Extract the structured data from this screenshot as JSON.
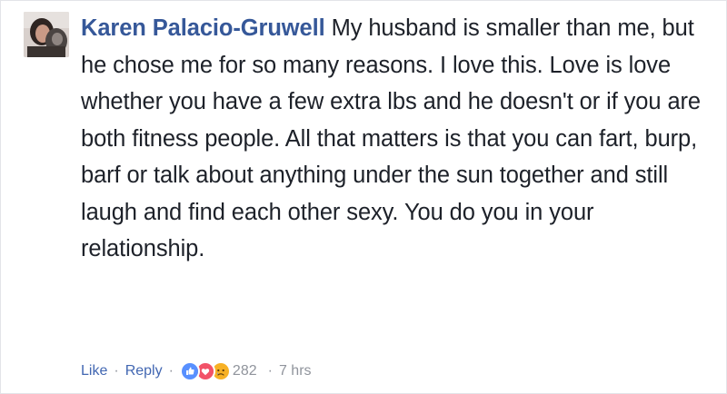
{
  "comment": {
    "author": "Karen Palacio-Gruwell",
    "text": "My husband is smaller than me, but he chose me for so many reasons. I love this. Love is love whether you have a few extra lbs and he doesn't or if you are both fitness people. All that matters is that you can fart, burp, barf or talk about anything under the sun together and still laugh and find each other sexy. You do you in your relationship."
  },
  "actions": {
    "like_label": "Like",
    "separator": "·",
    "reply_label": "Reply",
    "reaction_icons": [
      "like-icon",
      "love-icon",
      "sad-icon"
    ],
    "reaction_count": "282",
    "timestamp": "7 hrs"
  },
  "colors": {
    "author": "#365899",
    "link": "#4267b2",
    "meta": "#90949c",
    "text": "#1d2129",
    "like": "#5890ff",
    "love": "#f25268",
    "sad": "#f7b125"
  }
}
